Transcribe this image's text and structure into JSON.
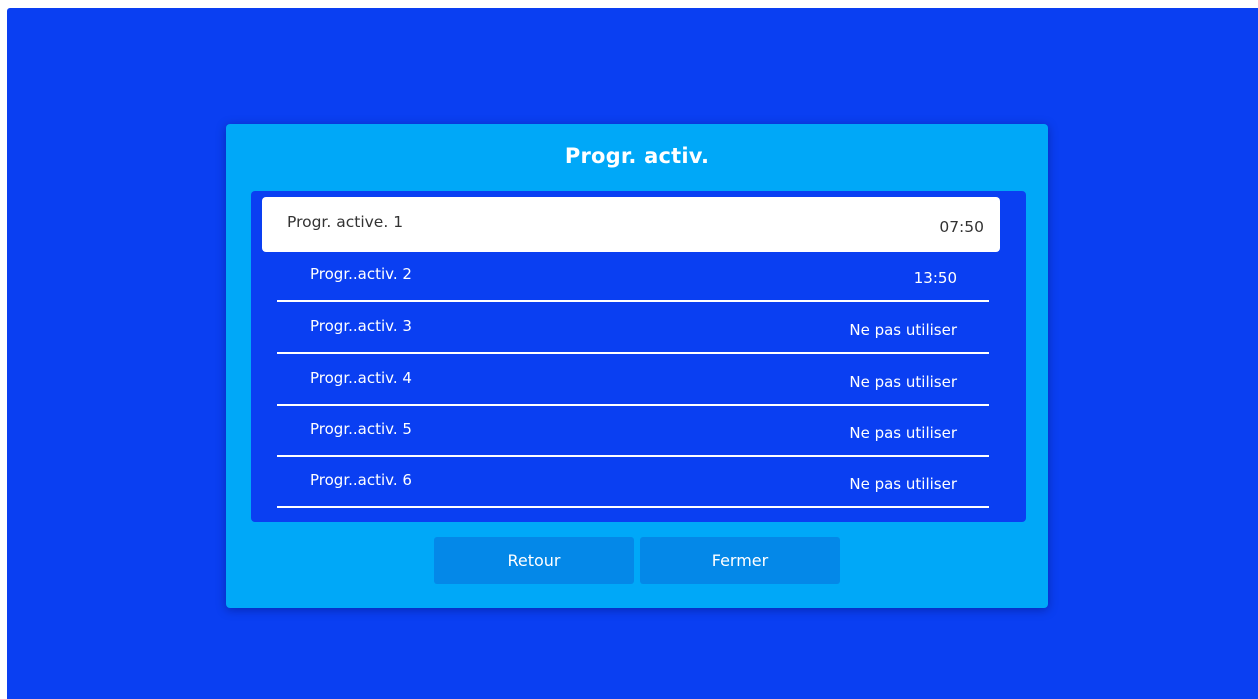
{
  "dialog": {
    "title": "Progr. activ."
  },
  "list": [
    {
      "label": "Progr. active. 1",
      "value": "07:50",
      "selected": true
    },
    {
      "label": "Progr..activ. 2",
      "value": "13:50",
      "selected": false
    },
    {
      "label": "Progr..activ. 3",
      "value": "Ne pas utiliser",
      "selected": false
    },
    {
      "label": "Progr..activ. 4",
      "value": "Ne pas utiliser",
      "selected": false
    },
    {
      "label": "Progr..activ. 5",
      "value": "Ne pas utiliser",
      "selected": false
    },
    {
      "label": "Progr..activ.  6",
      "value": "Ne pas utiliser",
      "selected": false
    }
  ],
  "buttons": {
    "back_label": "Retour",
    "close_label": "Fermer"
  },
  "colors": {
    "screen_background": "#0a3ff2",
    "dialog_background": "#00a8f8",
    "button_background": "#0488e8",
    "selected_row_background": "#ffffff"
  }
}
